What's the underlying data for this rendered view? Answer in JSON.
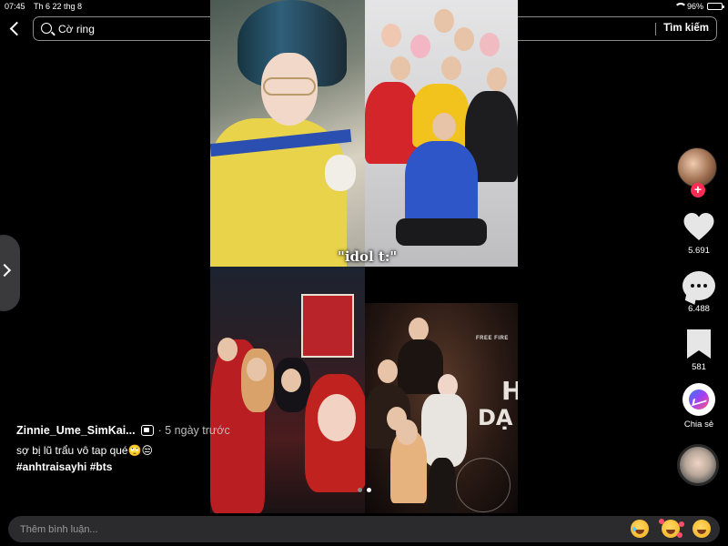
{
  "status_bar": {
    "time": "07:45",
    "date": "Th 6 22 thg 8",
    "battery": "96%",
    "battery_level": 0.96
  },
  "search": {
    "query": "Cờ ring",
    "button": "Tìm kiếm"
  },
  "video": {
    "caption": "\"idol t:\"",
    "overlay_brand": "FREE FIRE",
    "overlay_title_top": "H",
    "overlay_title_bottom": "DẠ",
    "slide_count": 2,
    "active_slide": 2
  },
  "actions": {
    "likes": "5.691",
    "comments": "6.488",
    "saves": "581",
    "share": "Chia sẻ"
  },
  "post": {
    "username": "Zinnie_Ume_SimKai...",
    "time": "· 5 ngày trước",
    "text": "sợ bị lũ trẩu vô tap qué🙄😒",
    "hashtags": [
      "#anhtraisayhi",
      "#bts"
    ]
  },
  "comment_bar": {
    "placeholder": "Thêm bình luận...",
    "emojis": [
      "laugh-emoji",
      "love-emoji",
      "grin-emoji"
    ]
  },
  "colors": {
    "follow": "#fe2c55",
    "background": "#000000",
    "comment_bar": "#2b2b2d"
  }
}
